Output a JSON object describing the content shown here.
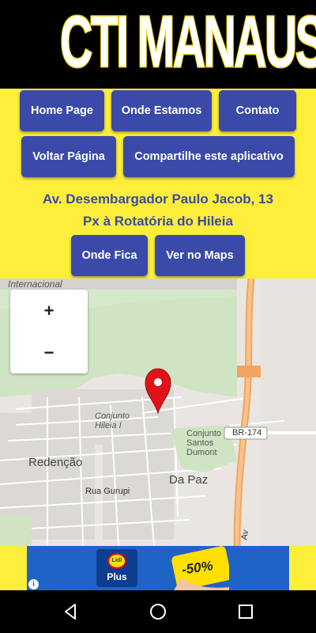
{
  "header": {
    "title": "CTI MANAUS"
  },
  "buttons": {
    "home": "Home Page",
    "onde_estamos": "Onde Estamos",
    "contato": "Contato",
    "voltar": "Voltar Página",
    "compartilhe": "Compartilhe este aplicativo",
    "onde_fica": "Onde Fica",
    "ver_maps": "Ver no Maps"
  },
  "address": {
    "line1": "Av. Desembargador Paulo Jacob, 13",
    "line2": "Px à Rotatória do Hileia"
  },
  "map": {
    "zoom_in": "+",
    "zoom_out": "−",
    "labels": {
      "internacional": "Internacional",
      "conjunto_hileia": "Conjunto\nHileia I",
      "redencao": "Redenção",
      "conjunto_santos": "Conjunto\nSantos\nDumont",
      "da_paz": "Da Paz",
      "rua_gurupi": "Rua Gurupi",
      "br174": "BR-174",
      "av": "Av"
    }
  },
  "ad": {
    "brand": "Lidl",
    "plus": "Plus",
    "discount": "-50%",
    "info": "i"
  },
  "colors": {
    "yellow": "#fdee3a",
    "button": "#3b4aa8",
    "pin": "#e0131a"
  },
  "icons": {
    "nav_back": "back-triangle-icon",
    "nav_home": "home-circle-icon",
    "nav_recent": "recent-square-icon"
  }
}
